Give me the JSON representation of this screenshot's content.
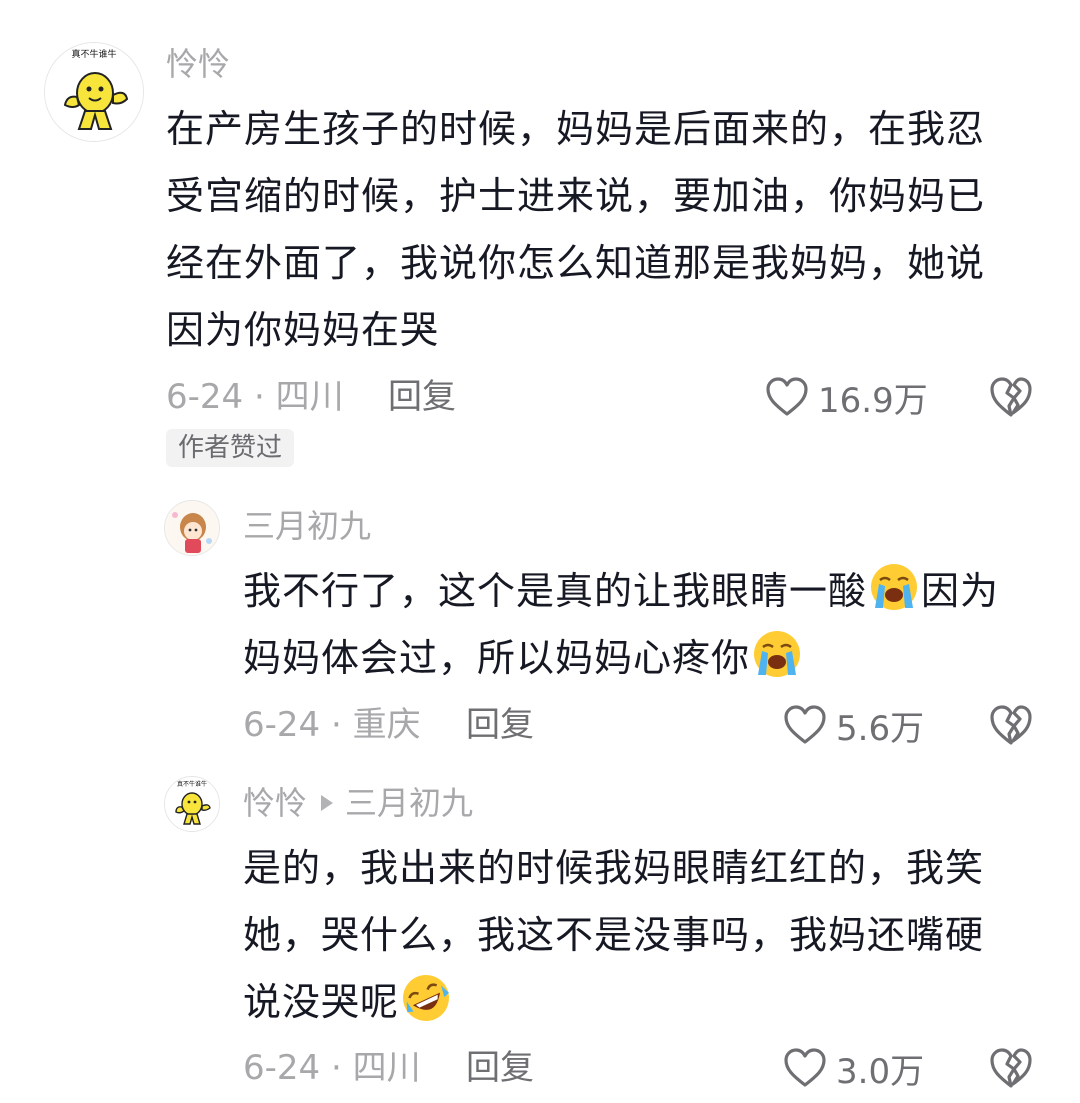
{
  "comments": [
    {
      "username": "怜怜",
      "text_lines": [
        "在产房生孩子的时候，妈妈是后面来的，在我忍",
        "受宫缩的时候，护士进来说，要加油，你妈妈已",
        "经在外面了，我说你怎么知道那是我妈妈，她说",
        "因为你妈妈在哭"
      ],
      "date_location": "6-24 · 四川",
      "reply_label": "回复",
      "likes": "16.9万",
      "badge": "作者赞过",
      "avatar_caption": "真不牛谁牛"
    },
    {
      "username": "三月初九",
      "text_lines": [
        "我不行了，这个是真的让我眼睛一酸",
        "因为",
        "妈妈体会过，所以妈妈心疼你"
      ],
      "date_location": "6-24 · 重庆",
      "reply_label": "回复",
      "likes": "5.6万"
    },
    {
      "username": "怜怜",
      "reply_to": "三月初九",
      "text_lines": [
        "是的，我出来的时候我妈眼睛红红的，我笑",
        "她，哭什么，我这不是没事吗，我妈还嘴硬",
        "说没哭呢"
      ],
      "date_location": "6-24 · 四川",
      "reply_label": "回复",
      "likes": "3.0万",
      "avatar_caption": "真不牛谁牛"
    }
  ],
  "icons": {
    "like": "heart-outline-icon",
    "dislike": "broken-heart-icon",
    "crying_emoji": "loudly-crying-face-emoji",
    "laughing_emoji": "rolling-on-floor-laughing-emoji"
  },
  "colors": {
    "text": "#161823",
    "muted": "#a8a8ab",
    "action": "#6f6f73",
    "avatar_yellow": "#f7e53b"
  }
}
